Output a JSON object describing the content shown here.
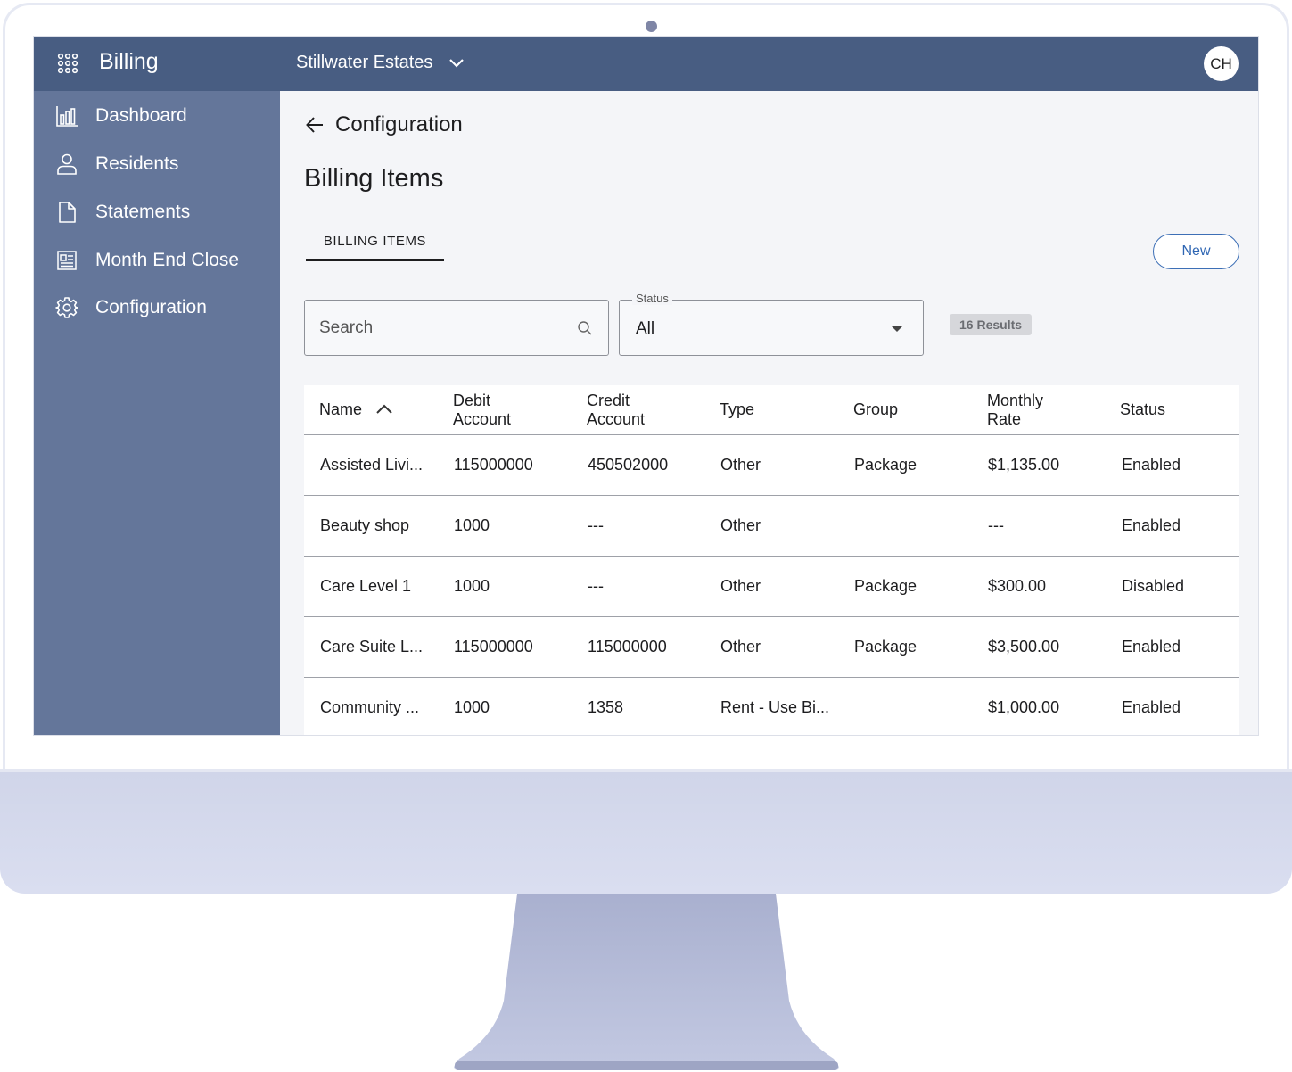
{
  "app": {
    "title": "Billing",
    "community": "Stillwater Estates",
    "user_initials": "CH"
  },
  "sidebar": {
    "items": [
      {
        "label": "Dashboard",
        "icon": "bar-chart-icon"
      },
      {
        "label": "Residents",
        "icon": "person-icon"
      },
      {
        "label": "Statements",
        "icon": "document-icon"
      },
      {
        "label": "Month End Close",
        "icon": "newspaper-icon"
      },
      {
        "label": "Configuration",
        "icon": "gear-icon"
      }
    ]
  },
  "main": {
    "back_label": "Configuration",
    "page_title": "Billing Items",
    "tab_label": "BILLING ITEMS",
    "new_label": "New",
    "search": {
      "placeholder": "Search",
      "value": ""
    },
    "status_filter": {
      "label": "Status",
      "value": "All"
    },
    "results": "16 Results"
  },
  "table": {
    "headers": {
      "name": "Name",
      "debit_1": "Debit",
      "debit_2": "Account",
      "credit_1": "Credit",
      "credit_2": "Account",
      "type": "Type",
      "group": "Group",
      "rate_1": "Monthly",
      "rate_2": "Rate",
      "status": "Status"
    },
    "rows": [
      {
        "name": "Assisted Livi...",
        "debit": "115000000",
        "credit": "450502000",
        "type": "Other",
        "group": "Package",
        "rate": "$1,135.00",
        "status": "Enabled"
      },
      {
        "name": "Beauty shop",
        "debit": "1000",
        "credit": "---",
        "type": "Other",
        "group": "",
        "rate": "---",
        "status": "Enabled"
      },
      {
        "name": "Care Level 1",
        "debit": "1000",
        "credit": "---",
        "type": "Other",
        "group": "Package",
        "rate": "$300.00",
        "status": "Disabled"
      },
      {
        "name": "Care Suite L...",
        "debit": "115000000",
        "credit": "115000000",
        "type": "Other",
        "group": "Package",
        "rate": "$3,500.00",
        "status": "Enabled"
      },
      {
        "name": "Community ...",
        "debit": "1000",
        "credit": "1358",
        "type": "Rent - Use Bi...",
        "group": "",
        "rate": "$1,000.00",
        "status": "Enabled"
      }
    ]
  },
  "colors": {
    "topbar": "#485d82",
    "sidebar": "#64769a",
    "accent": "#2f66b3"
  }
}
